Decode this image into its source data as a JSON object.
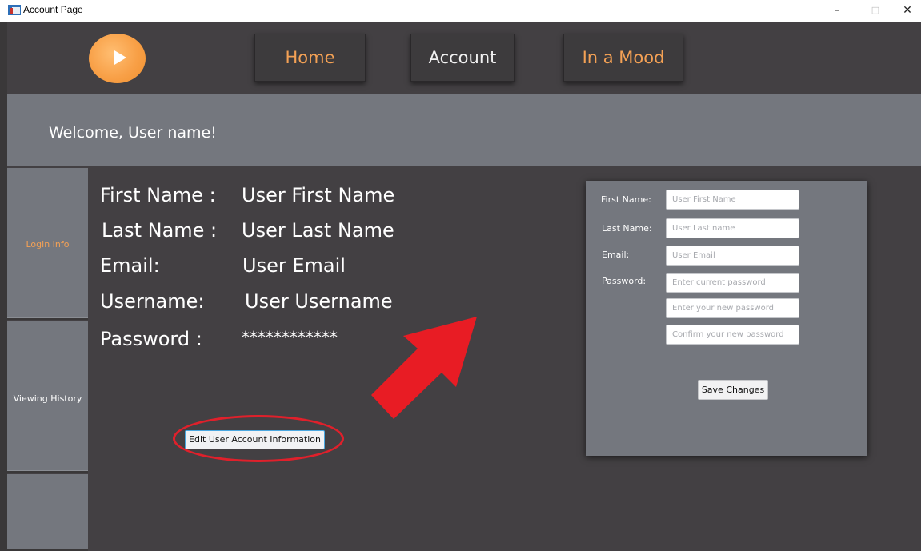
{
  "window": {
    "title": "Account Page",
    "minimize_glyph": "–",
    "maximize_glyph": "□",
    "close_glyph": "✕"
  },
  "nav": {
    "home_label": "Home",
    "account_label": "Account",
    "mood_label": "In a Mood"
  },
  "welcome": {
    "text": "Welcome, User name!"
  },
  "sidebar": {
    "items": [
      {
        "label": "Login Info"
      },
      {
        "label": "Viewing History"
      },
      {
        "label": ""
      }
    ]
  },
  "account_info": {
    "first_name_label": "First Name :",
    "first_name_value": "User First Name",
    "last_name_label": "Last Name :",
    "last_name_value": "User Last Name",
    "email_label": "Email:",
    "email_value": "User Email",
    "username_label": "Username:",
    "username_value": "User Username",
    "password_label": "Password :",
    "password_value": "************"
  },
  "edit_button_label": "Edit User Account Information",
  "edit_form": {
    "first_name_label": "First Name:",
    "first_name_placeholder": "User First Name",
    "last_name_label": "Last Name:",
    "last_name_placeholder": "User Last name",
    "email_label": "Email:",
    "email_placeholder": "User Email",
    "password_label": "Password:",
    "current_password_placeholder": "Enter current password",
    "new_password_placeholder": "Enter your new password",
    "confirm_password_placeholder": "Confirm your new password",
    "save_label": "Save Changes"
  },
  "colors": {
    "nav_background": "#434043",
    "accent_orange": "#f4a155",
    "panel_gray": "#74777e",
    "annotation_red": "#e0202b"
  },
  "icons": {
    "app": "app-window-icon",
    "logo": "play-logo-icon",
    "annotation": "red-arrow-icon"
  }
}
